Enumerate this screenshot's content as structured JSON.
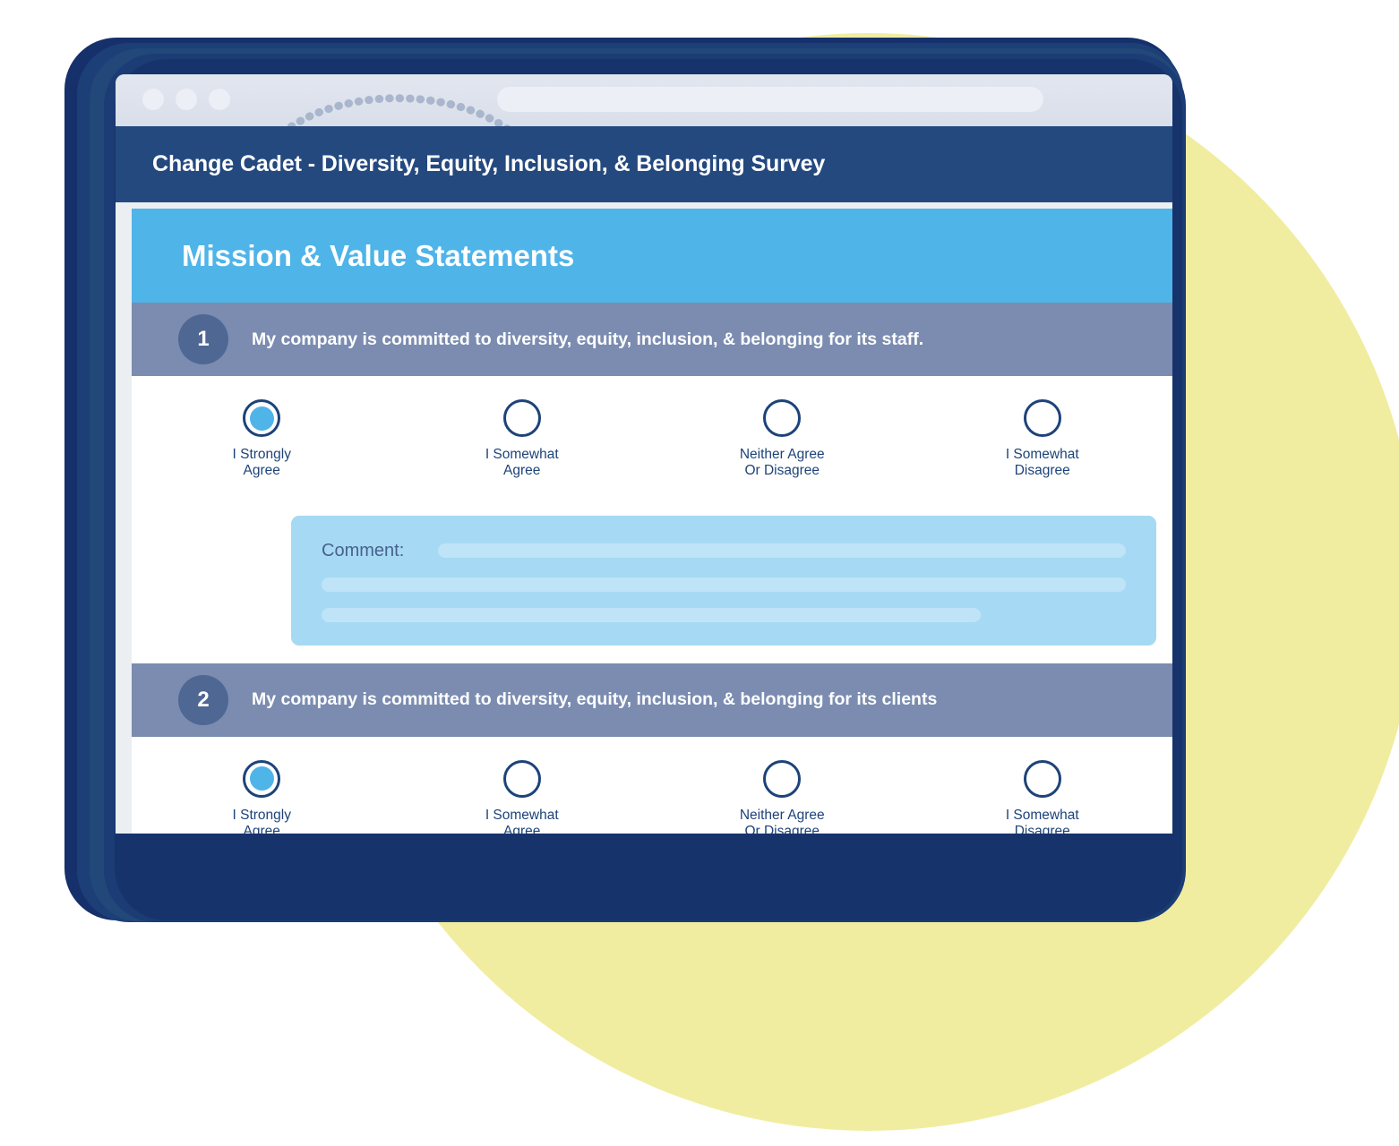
{
  "browser": {
    "traffic_lights": [
      "window-close-dot",
      "window-minimize-dot",
      "window-maximize-dot"
    ],
    "url_value": "",
    "url_placeholder": ""
  },
  "titlebar": {
    "title": "Change Cadet - Diversity, Equity, Inclusion, & Belonging Survey"
  },
  "section": {
    "title": "Mission & Value Statements"
  },
  "questions": [
    {
      "number": "1",
      "text": "My company is committed to diversity, equity, inclusion, & belonging for its staff.",
      "options": [
        {
          "label": "I Strongly\nAgree",
          "selected": true
        },
        {
          "label": "I Somewhat\nAgree",
          "selected": false
        },
        {
          "label": "Neither Agree\nOr Disagree",
          "selected": false
        },
        {
          "label": "I Somewhat\nDisagree",
          "selected": false
        }
      ],
      "comment": {
        "label": "Comment:",
        "value": "",
        "placeholder": ""
      }
    },
    {
      "number": "2",
      "text": "My company is committed to diversity, equity, inclusion, & belonging for its clients",
      "options": [
        {
          "label": "I Strongly\nAgree",
          "selected": true
        },
        {
          "label": "I Somewhat\nAgree",
          "selected": false
        },
        {
          "label": "Neither Agree\nOr Disagree",
          "selected": false
        },
        {
          "label": "I Somewhat\nDisagree",
          "selected": false
        }
      ]
    }
  ],
  "colors": {
    "titlebar_navy": "#24497f",
    "section_blue": "#4fb4e8",
    "question_band": "#7b8cb0",
    "question_badge": "#4f6793",
    "radio_ring": "#1d4379",
    "radio_fill": "#4fb4e8",
    "comment_panel": "#a6daf4",
    "accent_yellow": "#f0eda0",
    "frame_navy": "#16306b"
  }
}
